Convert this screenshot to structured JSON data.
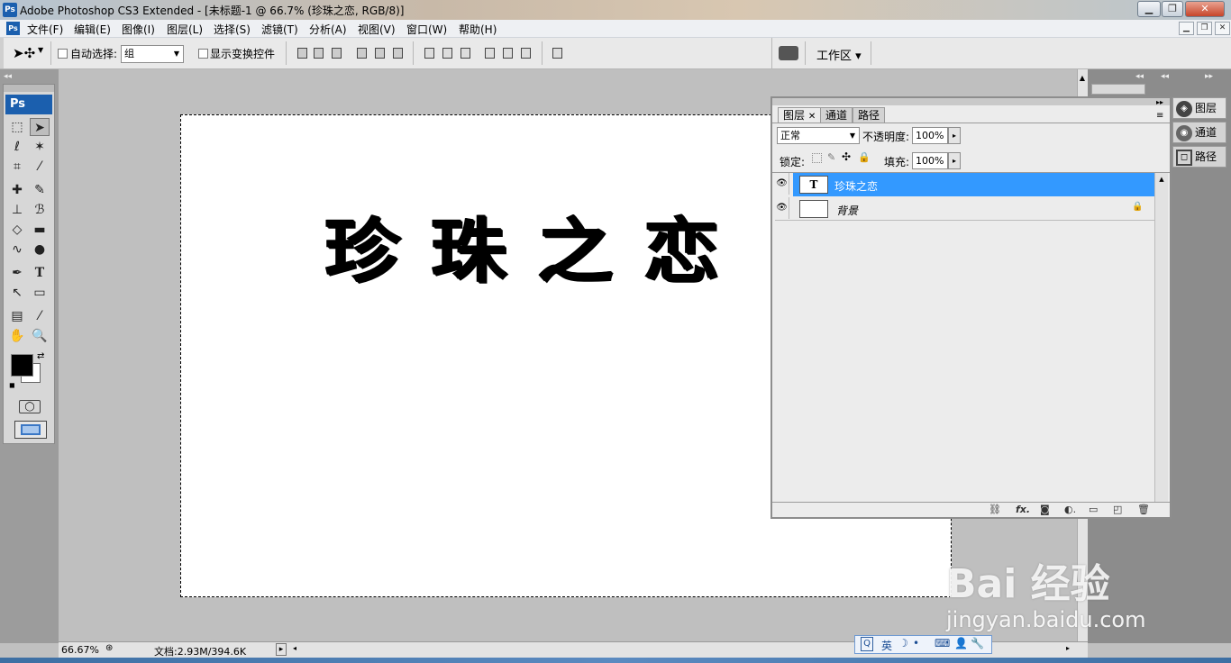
{
  "window": {
    "title": "Adobe Photoshop CS3 Extended - [未标题-1 @ 66.7% (珍珠之恋, RGB/8)]",
    "app_icon": "Ps"
  },
  "menu": [
    "文件(F)",
    "编辑(E)",
    "图像(I)",
    "图层(L)",
    "选择(S)",
    "滤镜(T)",
    "分析(A)",
    "视图(V)",
    "窗口(W)",
    "帮助(H)"
  ],
  "options": {
    "auto_select_label": "自动选择:",
    "auto_select_value": "组",
    "show_transform_label": "显示变换控件",
    "workspace_label": "工作区 ▾"
  },
  "toolbox": {
    "logo": "Ps"
  },
  "canvas": {
    "text": "珍珠之恋"
  },
  "layers_panel": {
    "tabs": [
      "图层",
      "通道",
      "路径"
    ],
    "blend_mode": "正常",
    "opacity_label": "不透明度:",
    "opacity_value": "100%",
    "lock_label": "锁定:",
    "fill_label": "填充:",
    "fill_value": "100%",
    "layers": [
      {
        "name": "珍珠之恋",
        "thumb": "T",
        "selected": true
      },
      {
        "name": "背景",
        "thumb": "",
        "selected": false,
        "locked": true
      }
    ]
  },
  "dock": [
    "图层",
    "通道",
    "路径"
  ],
  "status": {
    "zoom": "66.67%",
    "doc_info": "文档:2.93M/394.6K"
  },
  "ime": {
    "lang": "英"
  },
  "watermark": {
    "line1": "Bai 经验",
    "line2": "jingyan.baidu.com"
  },
  "colors": {
    "selection": "#3399ff",
    "ps_blue": "#1b5fae"
  }
}
